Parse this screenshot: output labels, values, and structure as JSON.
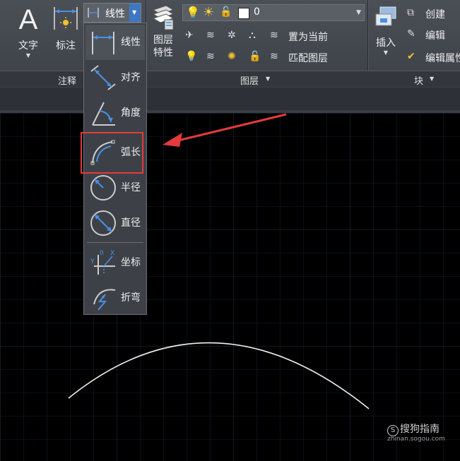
{
  "ribbon": {
    "text_button": "文字",
    "dimension_button": "标注",
    "annotation_panel": "注释",
    "dim_style_value": "线性",
    "layer_properties_line1": "图层",
    "layer_properties_line2": "特性",
    "layer_current_value": "0",
    "set_current": "置为当前",
    "match_layer": "匹配图层",
    "layers_panel": "图层",
    "insert_button": "插入",
    "create": "创建",
    "edit": "编辑",
    "edit_attributes": "编辑属性",
    "block_panel": "块"
  },
  "dimension_menu": {
    "items": [
      {
        "label": "线性",
        "icon": "linear-dim-icon"
      },
      {
        "label": "对齐",
        "icon": "aligned-dim-icon"
      },
      {
        "label": "角度",
        "icon": "angular-dim-icon"
      },
      {
        "label": "弧长",
        "icon": "arc-length-dim-icon"
      },
      {
        "label": "半径",
        "icon": "radius-dim-icon"
      },
      {
        "label": "直径",
        "icon": "diameter-dim-icon"
      },
      {
        "label": "坐标",
        "icon": "ordinate-dim-icon"
      },
      {
        "label": "折弯",
        "icon": "jogged-dim-icon"
      }
    ],
    "ordinate_icon_x": "X",
    "ordinate_icon_y": "Y",
    "ordinate_icon_zero": "0"
  },
  "colors": {
    "highlight": "#e43b3b",
    "accent_blue": "#4a90e2",
    "canvas_bg": "#000000",
    "grid": "#1e2a38"
  },
  "watermark": {
    "brand": "搜狗指南",
    "url": "zhinan.sogou.com"
  }
}
